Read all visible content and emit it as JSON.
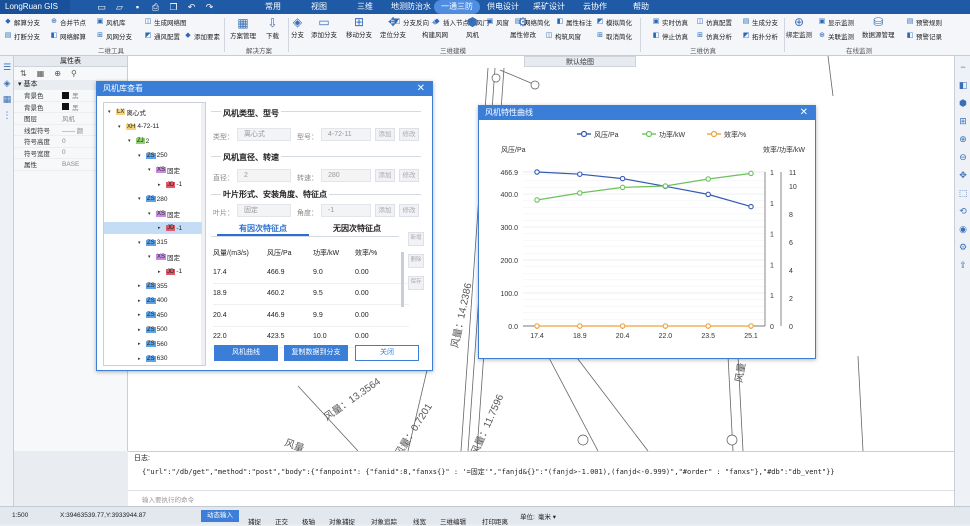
{
  "app": {
    "title": "LongRuan GIS",
    "menus": [
      "常用",
      "视图",
      "三维",
      "地测防治水",
      "一通三防",
      "供电设计",
      "采矿设计",
      "云协作",
      "帮助"
    ],
    "active_menu": "一通三防"
  },
  "ribbon": {
    "edit_tools": [
      "解算分支",
      "合并节点",
      "风机库",
      "生成网络图",
      "打断分支",
      "网络解算",
      "风网分支",
      "通风配置",
      "添加要素"
    ],
    "plan_tools": [
      "方案管理",
      "下载"
    ],
    "build_tools": [
      "分支",
      "添加分支",
      "移动分支",
      "定位分支",
      "构建风网",
      "风机",
      "属性修改",
      "分支反向",
      "插入节点",
      "风门",
      "风窗",
      "构筑风窗",
      "网络简化",
      "属性标注",
      "取消简化",
      "模拟简化"
    ],
    "sim_tools": [
      "实时仿真",
      "仿真配置",
      "生成分支",
      "停止仿真",
      "仿真分析",
      "拓扑分析"
    ],
    "monitor_tools": [
      "绑定监测",
      "关联监测",
      "显示监测",
      "数据源管理",
      "预警规则",
      "预警记录"
    ],
    "groups": [
      "二维工具",
      "解决方案",
      "三维建模",
      "三维仿真",
      "在线监测"
    ]
  },
  "props": {
    "title": "属性表",
    "section": "基本",
    "rows": [
      {
        "k": "背景色",
        "v": "黑"
      },
      {
        "k": "背景色",
        "v": "黑"
      },
      {
        "k": "图层",
        "v": "风机"
      },
      {
        "k": "线型符号",
        "v": "—— 颜"
      },
      {
        "k": "符号高度",
        "v": "0"
      },
      {
        "k": "符号宽度",
        "v": "0"
      },
      {
        "k": "属性",
        "v": "BASE"
      }
    ]
  },
  "map": {
    "tab": "默认绘图",
    "labels": [
      "风量：14.2386",
      "风量：13.3564",
      "风量：0.7201",
      "风量：11.7596",
      "风量",
      "风量"
    ]
  },
  "fan_dialog": {
    "title": "风机库查看",
    "tree": [
      {
        "lvl": 0,
        "tag": "LX",
        "text": "离心式",
        "tagc": "#f3d27a"
      },
      {
        "lvl": 1,
        "tag": "XH",
        "text": "4-72-11",
        "tagc": "#f3d27a"
      },
      {
        "lvl": 2,
        "tag": "ZJ",
        "text": "2",
        "tagc": "#8fd06f"
      },
      {
        "lvl": 3,
        "tag": "ZS",
        "text": "250",
        "tagc": "#5ea2e5"
      },
      {
        "lvl": 4,
        "tag": "XS",
        "text": "固定",
        "tagc": "#c58ce0"
      },
      {
        "lvl": 5,
        "tag": "JD",
        "text": "-1",
        "tagc": "#e05a6a"
      },
      {
        "lvl": 3,
        "tag": "ZS",
        "text": "280",
        "tagc": "#5ea2e5"
      },
      {
        "lvl": 4,
        "tag": "XS",
        "text": "固定",
        "tagc": "#c58ce0"
      },
      {
        "lvl": 5,
        "tag": "JD",
        "text": "-1",
        "tagc": "#e05a6a"
      },
      {
        "lvl": 3,
        "tag": "ZS",
        "text": "315",
        "tagc": "#5ea2e5"
      },
      {
        "lvl": 4,
        "tag": "XS",
        "text": "固定",
        "tagc": "#c58ce0"
      },
      {
        "lvl": 5,
        "tag": "JD",
        "text": "-1",
        "tagc": "#e05a6a"
      },
      {
        "lvl": 3,
        "tag": "ZS",
        "text": "355",
        "tagc": "#5ea2e5"
      },
      {
        "lvl": 3,
        "tag": "ZS",
        "text": "400",
        "tagc": "#5ea2e5"
      },
      {
        "lvl": 3,
        "tag": "ZS",
        "text": "450",
        "tagc": "#5ea2e5"
      },
      {
        "lvl": 3,
        "tag": "ZS",
        "text": "500",
        "tagc": "#5ea2e5"
      },
      {
        "lvl": 3,
        "tag": "ZS",
        "text": "560",
        "tagc": "#5ea2e5"
      },
      {
        "lvl": 3,
        "tag": "ZS",
        "text": "630",
        "tagc": "#5ea2e5"
      }
    ],
    "selected_index": 8,
    "sec1": "风机类型、型号",
    "type_label": "类型：",
    "type_value": "离心式",
    "model_label": "型号：",
    "model_value": "4-72-11",
    "sec2": "风机直径、转速",
    "dia_label": "直径：",
    "dia_value": "2",
    "speed_label": "转速：",
    "speed_value": "280",
    "sec3": "叶片形式、安装角度、特征点",
    "blade_label": "叶片：",
    "blade_value": "固定",
    "angle_label": "角度：",
    "angle_value": "-1",
    "add": "添加",
    "edit": "修改",
    "tab_a": "有因次特征点",
    "tab_b": "无因次特征点",
    "side_btns": [
      "新增",
      "删除",
      "保存"
    ],
    "table": {
      "headers": [
        "风量/(m3/s)",
        "风压/Pa",
        "功率/kW",
        "效率/%"
      ],
      "rows": [
        [
          "17.4",
          "466.9",
          "9.0",
          "0.00"
        ],
        [
          "18.9",
          "460.2",
          "9.5",
          "0.00"
        ],
        [
          "20.4",
          "446.9",
          "9.9",
          "0.00"
        ],
        [
          "22.0",
          "423.5",
          "10.0",
          "0.00"
        ]
      ]
    },
    "btn_curve": "风机曲线",
    "btn_copy": "复制数据到分支",
    "btn_close": "关闭"
  },
  "curve_dialog": {
    "title": "风机特性曲线"
  },
  "chart_data": {
    "type": "line",
    "x": [
      17.4,
      18.9,
      20.4,
      22.0,
      23.5,
      25.1
    ],
    "categories": [
      "17.4",
      "18.9",
      "20.4",
      "22.0",
      "23.5",
      "25.1"
    ],
    "series": [
      {
        "name": "风压/Pa",
        "values": [
          466.9,
          460.2,
          446.9,
          423.5,
          399,
          362
        ],
        "color": "#3558b5",
        "axis": "left"
      },
      {
        "name": "功率/kW",
        "values": [
          9.0,
          9.5,
          9.9,
          10.0,
          10.5,
          10.9
        ],
        "color": "#6cc25a",
        "axis": "right"
      },
      {
        "name": "效率/%",
        "values": [
          0,
          0,
          0,
          0,
          0,
          0
        ],
        "color": "#f0a23a",
        "axis": "right"
      }
    ],
    "ylabel_left": "风压/Pa",
    "ylabel_right": "效率/功率/kW",
    "ylim_left": [
      0,
      466.9
    ],
    "left_ticks": [
      "0.0",
      "100.0",
      "200.0",
      "300.0",
      "400.0",
      "466.9"
    ],
    "ylim_right": [
      0,
      11
    ],
    "right_ticks": [
      "0",
      "2",
      "4",
      "6",
      "8",
      "10",
      "11"
    ],
    "right_ticks_outer": [
      "0",
      "1",
      "1",
      "1",
      "1",
      "1"
    ],
    "legend": "top"
  },
  "log": {
    "title": "日志:",
    "line": "{\"url\":\"/db/get\",\"method\":\"post\",\"body\":{\"fanpoint\": {\"fanid\":8,\"fanxs{}\" : '=固定'\",\"fanjd&{}\":\"(fanjd>-1.001),(fanjd<-0.999)\",\"#order\" : \"fanxs\"},\"#db\":\"db_vent\"}}",
    "prompt": "输入要执行的命令"
  },
  "status": {
    "scale": "1:500",
    "coords": "X:39463539.77,Y:3933944.87",
    "items": [
      "动态输入",
      "捕捉",
      "正交",
      "极轴",
      "对象捕捉",
      "对象追踪",
      "线宽",
      "三维编辑",
      "打印距离"
    ],
    "unit_label": "单位:",
    "unit": "毫米"
  }
}
